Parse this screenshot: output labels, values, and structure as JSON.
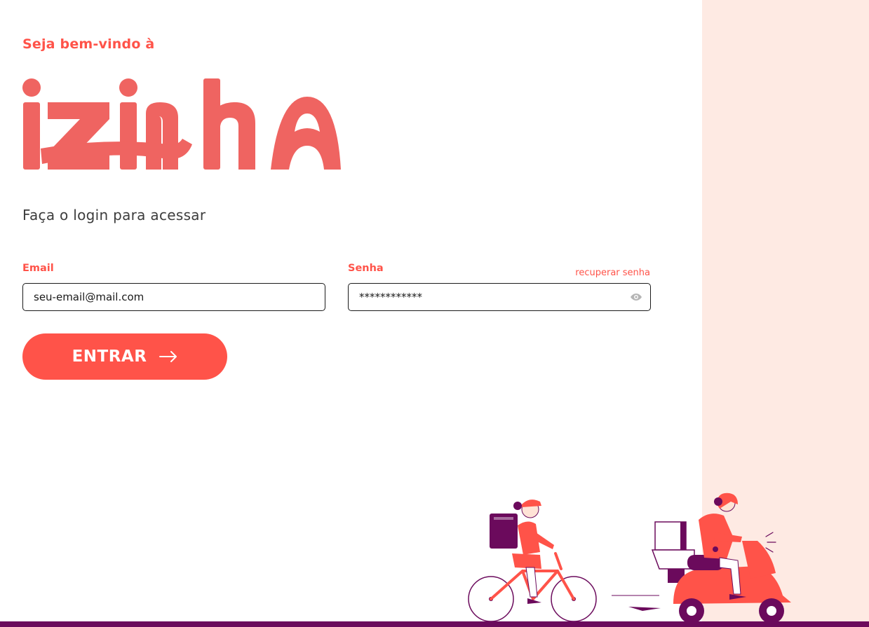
{
  "header": {
    "welcome_text": "Seja bem-vindo à",
    "brand_name": "izinha",
    "subtitle": "Faça o login para acessar"
  },
  "form": {
    "email": {
      "label": "Email",
      "value": "seu-email@mail.com"
    },
    "password": {
      "label": "Senha",
      "value": "************",
      "recover_link": "recuperar senha"
    },
    "submit_label": "ENTRAR"
  },
  "colors": {
    "accent": "#FF5349",
    "logo": "#EF6461",
    "panel": "#FEEAE3",
    "footer_bar": "#6B0A5C",
    "illustration_dark": "#6B0A5C"
  },
  "icons": {
    "password_toggle": "eye-icon",
    "submit": "arrow-right-icon"
  }
}
